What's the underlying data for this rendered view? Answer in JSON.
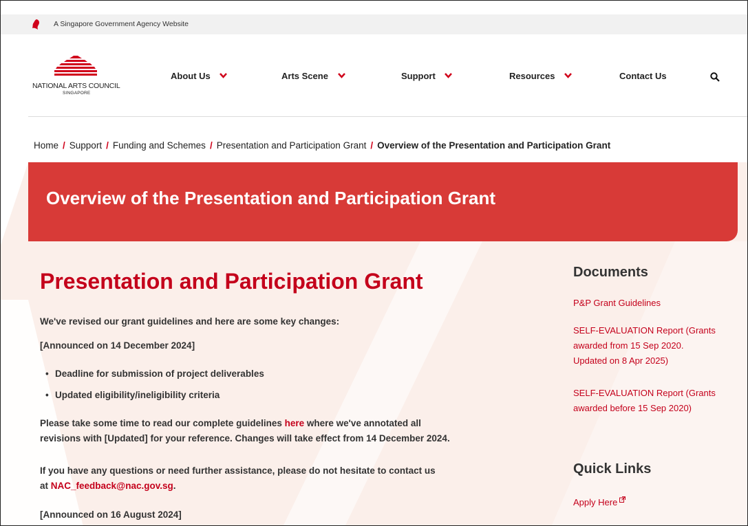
{
  "gov_bar": {
    "text": "A Singapore Government Agency Website"
  },
  "logo": {
    "name": "NATIONAL ARTS COUNCIL",
    "sub": "SINGAPORE"
  },
  "nav": [
    {
      "label": "About Us"
    },
    {
      "label": "Arts Scene"
    },
    {
      "label": "Support"
    },
    {
      "label": "Resources"
    },
    {
      "label": "Contact Us"
    }
  ],
  "breadcrumb": [
    "Home",
    "Support",
    "Funding and Schemes",
    "Presentation and Participation Grant",
    "Overview of the Presentation and Participation Grant"
  ],
  "breadcrumb_sep": "/",
  "banner": {
    "title": "Overview of the Presentation and Participation Grant"
  },
  "main": {
    "title": "Presentation and Participation Grant",
    "intro": "We've revised our grant guidelines and here are some key changes:",
    "announce_1": "[Announced on 14 December 2024]",
    "bullets": [
      "Deadline for submission of project deliverables",
      "Updated eligibility/ineligibility criteria"
    ],
    "read_prefix": "Please take some time to read our complete guidelines ",
    "read_link": "here",
    "read_suffix": " where we've annotated all",
    "read_line2": "revisions with [Updated] for your reference. Changes will take effect from 14 December 2024.",
    "contact_line1": "If you have any questions or need further assistance, please do not hesitate to contact us",
    "contact_prefix": "at ",
    "contact_email": "NAC_feedback@nac.gov.sg",
    "contact_suffix": ".",
    "announce_2": "[Announced on 16 August 2024]"
  },
  "sidebar": {
    "documents_heading": "Documents",
    "documents": [
      {
        "lines": [
          "P&P Grant Guidelines"
        ]
      },
      {
        "lines": [
          "SELF-EVALUATION Report (Grants",
          "awarded from 15 Sep 2020.",
          "Updated on 8 Apr 2025)"
        ]
      },
      {
        "lines": [
          "SELF-EVALUATION Report (Grants",
          "awarded before 15 Sep 2020)"
        ]
      }
    ],
    "quick_links_heading": "Quick Links",
    "apply_here": "Apply Here"
  },
  "colors": {
    "brand_red": "#d83a37",
    "link_red": "#c4001b",
    "wash": "#fbefea"
  },
  "icons": [
    "lion-head-icon",
    "chevron-down-icon",
    "search-icon",
    "external-link-icon"
  ]
}
